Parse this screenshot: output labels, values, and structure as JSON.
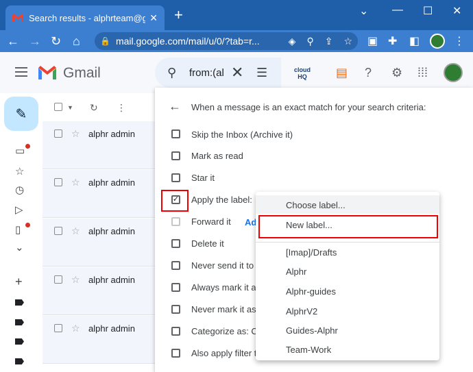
{
  "browser": {
    "tab_title": "Search results - alphrteam@gma",
    "tab_close": "✕",
    "new_tab": "+",
    "url": "mail.google.com/mail/u/0/?tab=r...",
    "window_controls": [
      "minimize",
      "maximize",
      "close"
    ]
  },
  "gmail": {
    "product_name": "Gmail",
    "search": {
      "query": "from:(al"
    },
    "cloudhq_label": "cloud HQ"
  },
  "mail_list": {
    "rows": [
      {
        "from": "alphr admin"
      },
      {
        "from": "alphr admin"
      },
      {
        "from": "alphr admin"
      },
      {
        "from": "alphr admin"
      },
      {
        "from": "alphr admin"
      }
    ]
  },
  "filter_dialog": {
    "title": "When a message is an exact match for your search criteria:",
    "options": [
      {
        "label": "Skip the Inbox (Archive it)",
        "checked": false
      },
      {
        "label": "Mark as read",
        "checked": false
      },
      {
        "label": "Star it",
        "checked": false
      },
      {
        "label": "Apply the label:",
        "checked": true
      },
      {
        "label": "Forward it",
        "checked": false,
        "disabled": true
      },
      {
        "label": "Delete it",
        "checked": false
      },
      {
        "label": "Never send it to S",
        "checked": false
      },
      {
        "label": "Always mark it as",
        "checked": false
      },
      {
        "label": "Never mark it as",
        "checked": false
      },
      {
        "label": "Categorize as:  C",
        "checked": false
      },
      {
        "label": "Also apply filter t",
        "checked": false
      }
    ],
    "forward_add_link": "Ad"
  },
  "label_menu": {
    "choose_label": "Choose label...",
    "new_label": "New label...",
    "labels": [
      "[Imap]/Drafts",
      "Alphr",
      "Alphr-guides",
      "AlphrV2",
      "Guides-Alphr",
      "Team-Work"
    ]
  },
  "colors": {
    "chrome_dark": "#1f5ea8",
    "chrome_light": "#3c7fd0",
    "highlight_red": "#ee0000",
    "compose_bg": "#c2e7ff"
  }
}
